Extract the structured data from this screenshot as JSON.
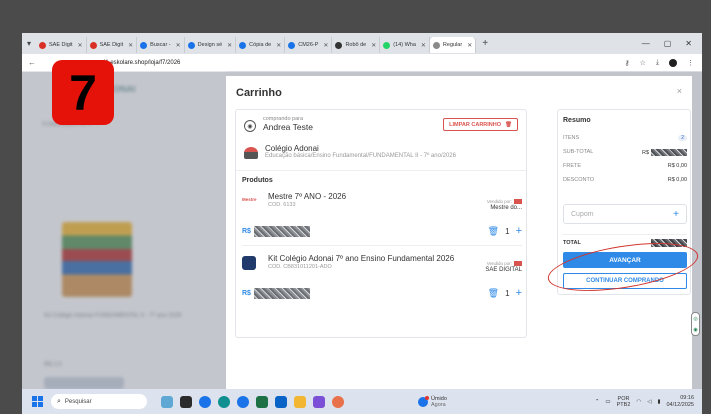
{
  "browser": {
    "tabs": [
      {
        "label": "SAE Digit",
        "color": "#d93025",
        "active": false
      },
      {
        "label": "SAE Digit",
        "color": "#d93025",
        "active": false
      },
      {
        "label": "Buscar - ",
        "color": "#1a73e8",
        "active": false
      },
      {
        "label": "Design sé",
        "color": "#1a73e8",
        "active": false
      },
      {
        "label": "Cópia de ",
        "color": "#1a73e8",
        "active": false
      },
      {
        "label": "CM26-P",
        "color": "#1a73e8",
        "active": false
      },
      {
        "label": "Robô de ",
        "color": "#333333",
        "active": false
      },
      {
        "label": "(14) Wha",
        "color": "#25d366",
        "active": false
      },
      {
        "label": "Regular ",
        "color": "#8a8a8a",
        "active": true
      }
    ],
    "url": "i1.eskolare.shop/loja/f7/2026"
  },
  "step_badge": "7",
  "background_page": {
    "title": "ADONAI",
    "subtitle": "FUNDAMENTAL II - 7",
    "product_desc": "Kit Colégio Adonai FUNDAMENTAL II - 7º ano 2026",
    "price": "R$ 2.0",
    "button": "ADICIONAR"
  },
  "modal": {
    "title": "Carrinho",
    "close": "×",
    "buying_for_label": "comprando para",
    "buyer_name": "Andrea Teste",
    "clear_cart": "LIMPAR CARRINHO",
    "school_name": "Colégio Adonai",
    "school_desc": "Educação básica/Ensino Fundamental/FUNDAMENTAL II - 7º ano/2026",
    "products_heading": "Produtos",
    "products": [
      {
        "name": "Mestre 7º ANO - 2026",
        "code": "COD. 6133",
        "sold_by_label": "Vendido por:",
        "seller": "Mestre do...",
        "currency": "R$",
        "qty": "1"
      },
      {
        "name": "Kit Colégio Adonai 7º ano Ensino Fundamental 2026",
        "code": "COD. CB831011201-ADO",
        "sold_by_label": "Vendido por:",
        "seller": "SAE DIGITAL",
        "currency": "R$",
        "qty": "1"
      }
    ]
  },
  "summary": {
    "title": "Resumo",
    "items_label": "ITENS",
    "items_count": "2",
    "subtotal_label": "SUB-TOTAL",
    "subtotal_currency": "R$",
    "shipping_label": "FRETE",
    "shipping_value": "R$ 0,00",
    "discount_label": "DESCONTO",
    "discount_value": "R$ 0,00",
    "coupon_placeholder": "Cupom",
    "total_label": "TOTAL",
    "advance_button": "AVANÇAR",
    "continue_button": "CONTINUAR COMPRANDO"
  },
  "taskbar": {
    "search_placeholder": "Pesquisar",
    "weather_title": "Úmido",
    "weather_sub": "Agora",
    "lang_top": "POR",
    "lang_bottom": "PTB2",
    "time": "09:16",
    "date": "04/12/2025"
  }
}
